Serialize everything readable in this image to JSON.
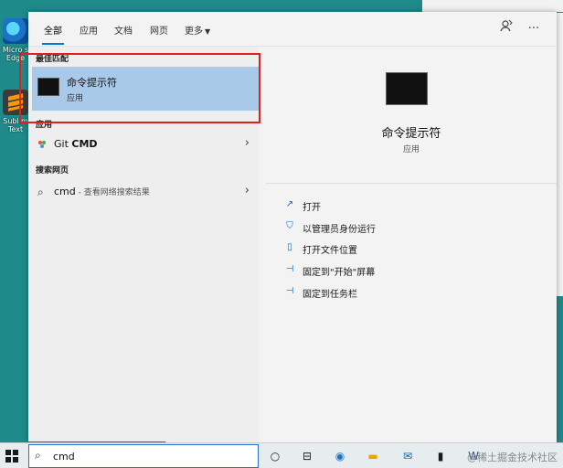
{
  "desktop": {
    "icons": [
      {
        "label_line1": "Micro s",
        "label_line2": "Edge"
      },
      {
        "label_line1": "Sublim",
        "label_line2": "Text"
      }
    ]
  },
  "tabs": [
    {
      "label": "全部"
    },
    {
      "label": "应用"
    },
    {
      "label": "文档"
    },
    {
      "label": "网页"
    },
    {
      "label": "更多"
    }
  ],
  "toolbar": {
    "feedback_icon": "person-feedback-icon",
    "more_icon": "ellipsis-icon"
  },
  "left": {
    "best_match_header": "最佳匹配",
    "best_match": {
      "title": "命令提示符",
      "subtitle": "应用"
    },
    "apps_header": "应用",
    "app_result": {
      "prefix": "Git ",
      "bold": "CMD"
    },
    "web_header": "搜索网页",
    "web_result": {
      "query": "cmd",
      "hint": " - 查看网络搜索结果"
    }
  },
  "right": {
    "title": "命令提示符",
    "subtitle": "应用",
    "actions": [
      {
        "label": "打开",
        "icon": "open-icon"
      },
      {
        "label": "以管理员身份运行",
        "icon": "shield-icon"
      },
      {
        "label": "打开文件位置",
        "icon": "file-location-icon"
      },
      {
        "label": "固定到\"开始\"屏幕",
        "icon": "pin-icon"
      },
      {
        "label": "固定到任务栏",
        "icon": "pin-icon"
      }
    ]
  },
  "taskbar": {
    "search_value": "cmd",
    "watermark": "@稀土掘金技术社区"
  },
  "colors": {
    "accent": "#0078d4",
    "selection": "#a9c9e8",
    "highlight_box": "#e02020"
  }
}
